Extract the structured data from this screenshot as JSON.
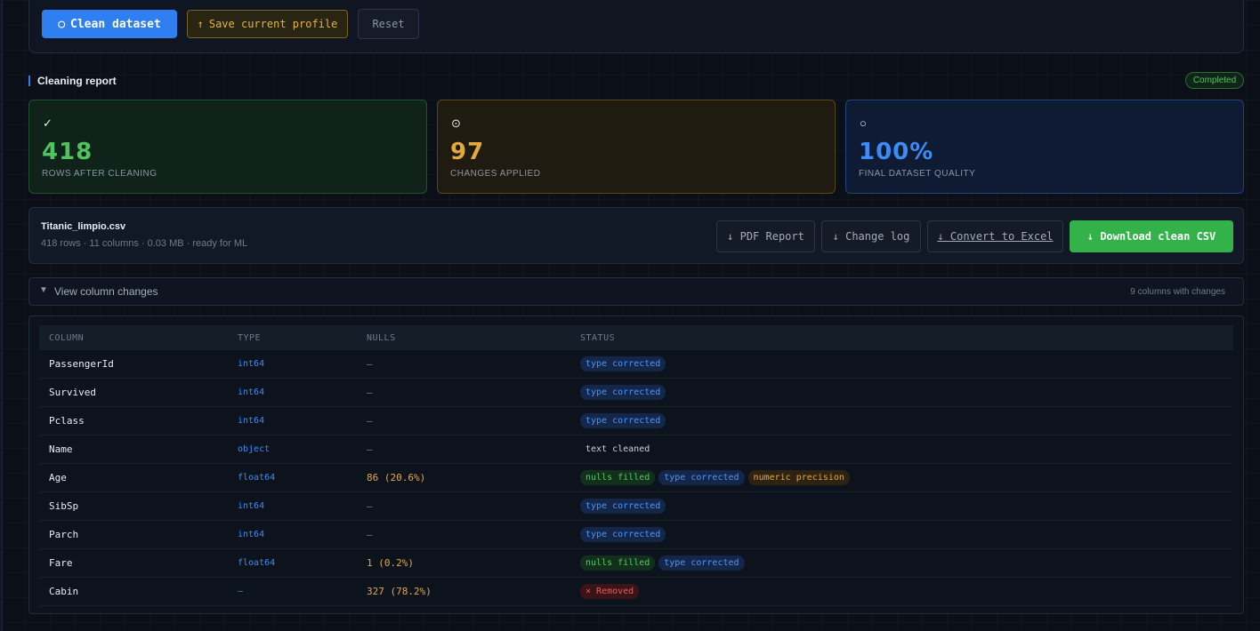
{
  "toolbar": {
    "clean_icon": "○",
    "clean_label": "Clean dataset",
    "save_icon": "↑",
    "save_label": "Save current profile",
    "reset_label": "Reset"
  },
  "report": {
    "title": "Cleaning report",
    "status_badge": "Completed"
  },
  "stats": [
    {
      "icon": "✓",
      "value": "418",
      "label": "ROWS AFTER CLEANING",
      "color": "#4fc45e"
    },
    {
      "icon": "⊙",
      "value": "97",
      "label": "CHANGES APPLIED",
      "color": "#e3a93b"
    },
    {
      "icon": "○",
      "value": "100%",
      "label": "FINAL DATASET QUALITY",
      "color": "#3d8bf5"
    }
  ],
  "file": {
    "name": "Titanic_limpio.csv",
    "meta": "418 rows · 11 columns · 0.03 MB · ready for ML",
    "pdf_label": "↓ PDF Report",
    "log_label": "↓ Change log",
    "excel_label": "↓ Convert to Excel",
    "download_label": "↓ Download clean CSV"
  },
  "changes": {
    "toggle_icon": "▼",
    "label": "View column changes",
    "count": "9 columns with changes"
  },
  "table": {
    "headers": {
      "column": "COLUMN",
      "type": "TYPE",
      "nulls": "NULLS",
      "status": "STATUS"
    },
    "rows": [
      {
        "name": "PassengerId",
        "type": "int64",
        "nulls": "—",
        "tags": [
          {
            "text": "type corrected",
            "kind": "blue"
          }
        ]
      },
      {
        "name": "Survived",
        "type": "int64",
        "nulls": "—",
        "tags": [
          {
            "text": "type corrected",
            "kind": "blue"
          }
        ]
      },
      {
        "name": "Pclass",
        "type": "int64",
        "nulls": "—",
        "tags": [
          {
            "text": "type corrected",
            "kind": "blue"
          }
        ]
      },
      {
        "name": "Name",
        "type": "object",
        "nulls": "—",
        "tags": [
          {
            "text": "text cleaned",
            "kind": "plain"
          }
        ]
      },
      {
        "name": "Age",
        "type": "float64",
        "nulls": "86 (20.6%)",
        "tags": [
          {
            "text": "nulls filled",
            "kind": "green"
          },
          {
            "text": "type corrected",
            "kind": "blue"
          },
          {
            "text": "numeric precision",
            "kind": "amber"
          }
        ]
      },
      {
        "name": "SibSp",
        "type": "int64",
        "nulls": "—",
        "tags": [
          {
            "text": "type corrected",
            "kind": "blue"
          }
        ]
      },
      {
        "name": "Parch",
        "type": "int64",
        "nulls": "—",
        "tags": [
          {
            "text": "type corrected",
            "kind": "blue"
          }
        ]
      },
      {
        "name": "Fare",
        "type": "float64",
        "nulls": "1 (0.2%)",
        "tags": [
          {
            "text": "nulls filled",
            "kind": "green"
          },
          {
            "text": "type corrected",
            "kind": "blue"
          }
        ]
      },
      {
        "name": "Cabin",
        "type": "—",
        "nulls": "327 (78.2%)",
        "tags": [
          {
            "text": "× Removed",
            "kind": "red"
          }
        ]
      }
    ]
  }
}
